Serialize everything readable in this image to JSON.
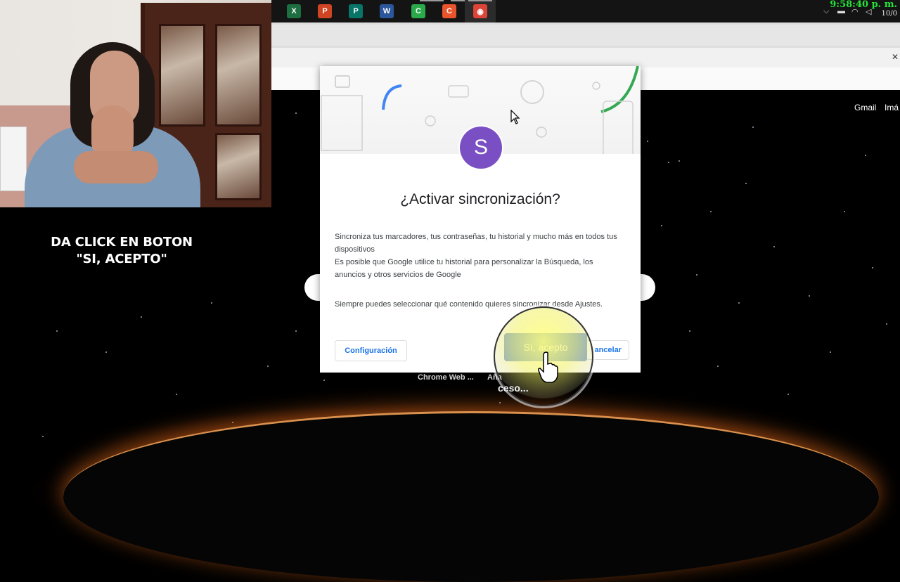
{
  "taskbar": {
    "apps": [
      {
        "name": "excel-icon",
        "glyph": "X",
        "color": "#1d6f42"
      },
      {
        "name": "powerpoint-icon",
        "glyph": "P",
        "color": "#d04423"
      },
      {
        "name": "publisher-icon",
        "glyph": "P",
        "color": "#077568"
      },
      {
        "name": "word-icon",
        "glyph": "W",
        "color": "#2b579a"
      },
      {
        "name": "camtasia-icon",
        "glyph": "C",
        "color": "#2aa84a"
      },
      {
        "name": "camtasia-recorder-icon",
        "glyph": "C",
        "color": "#e8552c"
      },
      {
        "name": "chrome-icon",
        "glyph": "◉",
        "color": "#db4437"
      }
    ],
    "clock_time": "9:58:40 p. m.",
    "clock_date": "10/0"
  },
  "google_top": {
    "gmail": "Gmail",
    "images": "Imá"
  },
  "caption": {
    "line1": "DA CLICK EN BOTON",
    "line2": "\"SI, ACEPTO\""
  },
  "dialog": {
    "avatar_letter": "S",
    "title": "¿Activar sincronización?",
    "para1": "Sincroniza tus marcadores, tus contraseñas, tu historial y mucho más en todos tus dispositivos",
    "para2": "Es posible que Google utilice tu historial para personalizar la Búsqueda, los anuncios y otros servicios de Google",
    "para3": "Siempre puedes seleccionar qué contenido quieres sincronizar desde Ajustes.",
    "settings_button": "Configuración",
    "accept_button": "Sí, acepto",
    "cancel_button": "ancelar"
  },
  "shortcuts": {
    "item1": "Chrome Web ...",
    "item2": "Aña",
    "item3": "ceso..."
  },
  "colors": {
    "accent": "#1a73e8",
    "avatar": "#7a4fc4",
    "clock": "#27e33a"
  }
}
